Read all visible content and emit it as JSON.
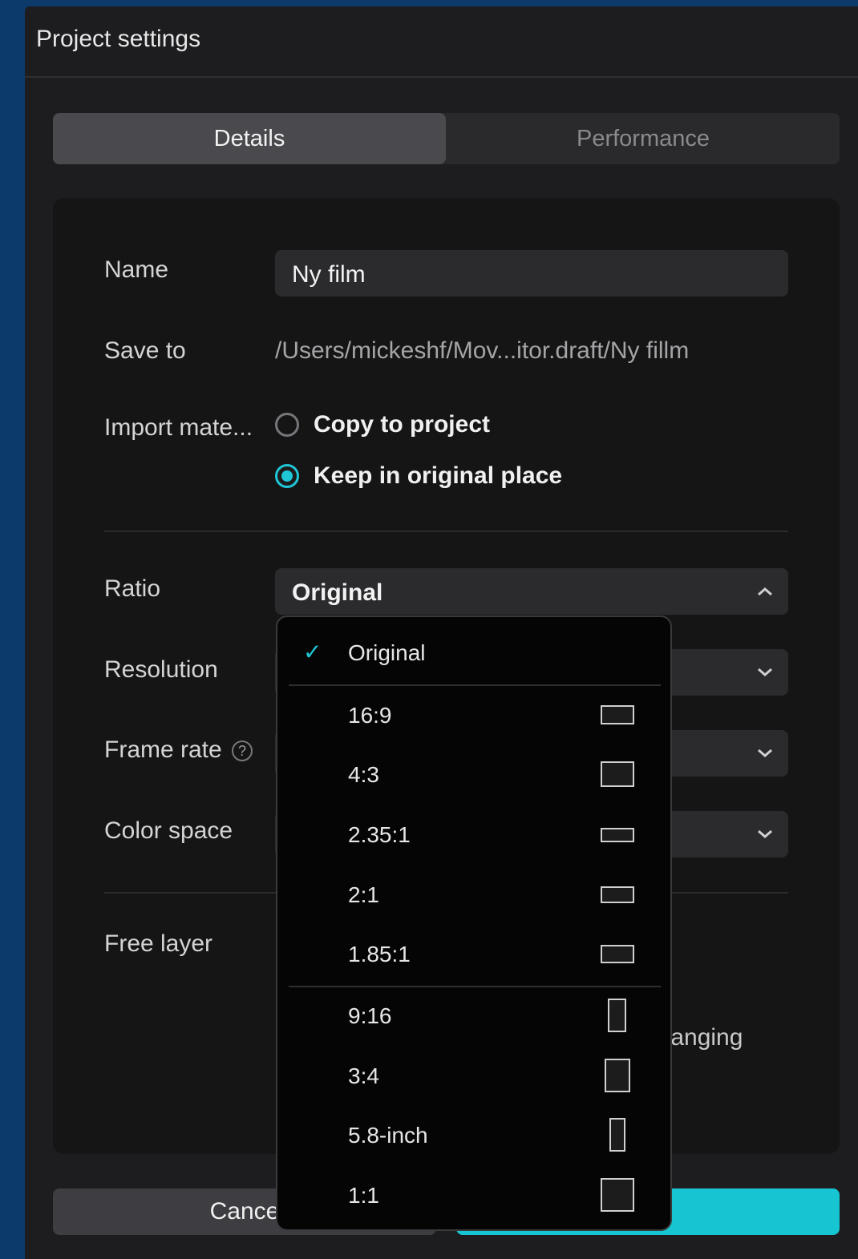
{
  "dialog": {
    "title": "Project settings"
  },
  "tabs": [
    {
      "label": "Details",
      "active": true
    },
    {
      "label": "Performance",
      "active": false
    }
  ],
  "details": {
    "name_label": "Name",
    "name_value": "Ny film",
    "save_label": "Save to",
    "save_path": "/Users/mickeshf/Mov...itor.draft/Ny fillm",
    "import_label": "Import mate...",
    "import_options": [
      {
        "label": "Copy to project",
        "selected": false
      },
      {
        "label": "Keep in original place",
        "selected": true
      }
    ],
    "ratio_label": "Ratio",
    "ratio_value": "Original",
    "resolution_label": "Resolution",
    "framerate_label": "Frame rate",
    "colorspace_label": "Color space",
    "freelayer_label": "Free layer",
    "freelayer_partial_text": "ıanging"
  },
  "ratio_options": [
    {
      "label": "Original",
      "selected": true,
      "icon": "none"
    },
    {
      "label": "16:9",
      "icon": "landscape-icon"
    },
    {
      "label": "4:3",
      "icon": "landscape-icon"
    },
    {
      "label": "2.35:1",
      "icon": "landscape-icon"
    },
    {
      "label": "2:1",
      "icon": "landscape-icon"
    },
    {
      "label": "1.85:1",
      "icon": "landscape-icon"
    },
    {
      "label": "9:16",
      "icon": "portrait-icon"
    },
    {
      "label": "3:4",
      "icon": "portrait-icon"
    },
    {
      "label": "5.8-inch",
      "icon": "portrait-icon"
    },
    {
      "label": "1:1",
      "icon": "square-icon"
    }
  ],
  "buttons": {
    "cancel_label": "Cance"
  },
  "colors": {
    "accent": "#1fc6d6",
    "background": "#0c3a6b",
    "dialog": "#1d1d1f"
  }
}
